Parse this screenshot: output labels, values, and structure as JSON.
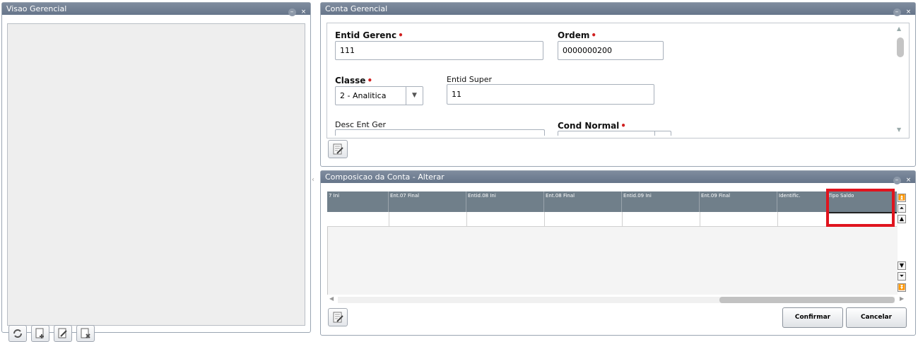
{
  "left_panel": {
    "title": "Visao Gerencial",
    "min_glyph": "–",
    "close_glyph": "×",
    "toolbar_icons": [
      "refresh-icon",
      "add-doc-icon",
      "edit-doc-icon",
      "delete-doc-icon"
    ]
  },
  "conta_panel": {
    "title": "Conta Gerencial",
    "min_glyph": "–",
    "close_glyph": "×",
    "fields": {
      "entid_gerenc": {
        "label": "Entid Gerenc",
        "value": "111"
      },
      "ordem": {
        "label": "Ordem",
        "value": "0000000200"
      },
      "classe": {
        "label": "Classe",
        "value": "2 - Analitica"
      },
      "entid_super": {
        "label": "Entid Super",
        "value": "11"
      },
      "desc_ent_ger": {
        "label": "Desc Ent Ger",
        "value": ""
      },
      "cond_normal": {
        "label": "Cond Normal",
        "value": ""
      }
    },
    "required_mark": "•"
  },
  "composicao_panel": {
    "title": "Composicao da Conta - Alterar",
    "min_glyph": "–",
    "close_glyph": "×",
    "columns": [
      "7 Ini",
      "Ent.07 Final",
      "Entid.08 Ini",
      "Ent.08 Final",
      "Entid.09 Ini",
      "Ent.09 Final",
      "Identific.",
      "Tipo Saldo"
    ],
    "highlight_column": "Tipo Saldo",
    "highlight_color": "#e0141e",
    "confirm_label": "Confirmar",
    "cancel_label": "Cancelar"
  },
  "colors": {
    "header_bg": "#6c7b8f",
    "grid_header_bg": "#707f8a",
    "required": "#d02020"
  }
}
